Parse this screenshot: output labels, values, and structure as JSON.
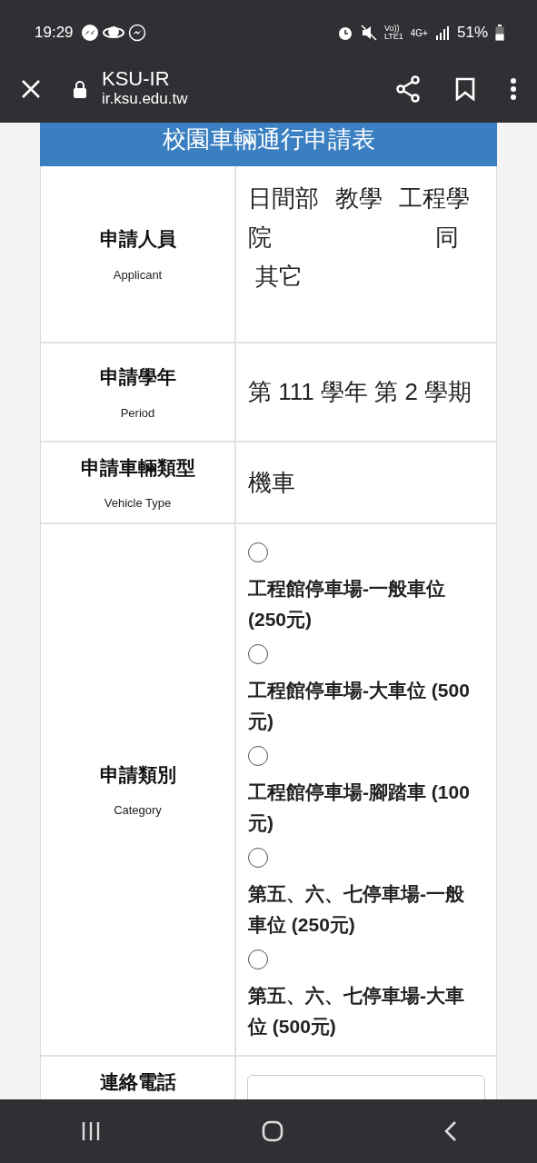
{
  "status_bar": {
    "time": "19:29",
    "volte": "Vo))",
    "lte": "LTE1",
    "network": "4G+",
    "battery": "51%"
  },
  "browser_bar": {
    "site_title": "KSU-IR",
    "url": "ir.ksu.edu.tw"
  },
  "form": {
    "title": "校園車輛通行申請表",
    "rows": [
      {
        "kind": "applicant",
        "label": "申請人員",
        "label_en": "Applicant",
        "lines": [
          [
            "日間部",
            "教學",
            "工程學"
          ],
          [
            "院",
            "同"
          ],
          [
            "其它"
          ]
        ]
      },
      {
        "kind": "text",
        "label": "申請學年",
        "label_en": "Period",
        "value": "第 111 學年 第 2 學期"
      },
      {
        "kind": "text",
        "label": "申請車輛類型",
        "label_en": "Vehicle Type",
        "value": "機車"
      },
      {
        "kind": "radios",
        "label": "申請類別",
        "label_en": "Category",
        "options": [
          {
            "text": "工程館停車場-一般車位 (250元)",
            "selected": false
          },
          {
            "text": "工程館停車場-大車位 (500元)",
            "selected": false
          },
          {
            "text": "工程館停車場-腳踏車 (100元)",
            "selected": false
          },
          {
            "text": "第五、六、七停車場-一般車位 (250元)",
            "selected": false
          },
          {
            "text": "第五、六、七停車場-大車位 (500元)",
            "selected": false
          }
        ]
      },
      {
        "kind": "input",
        "label": "連絡電話"
      }
    ]
  }
}
